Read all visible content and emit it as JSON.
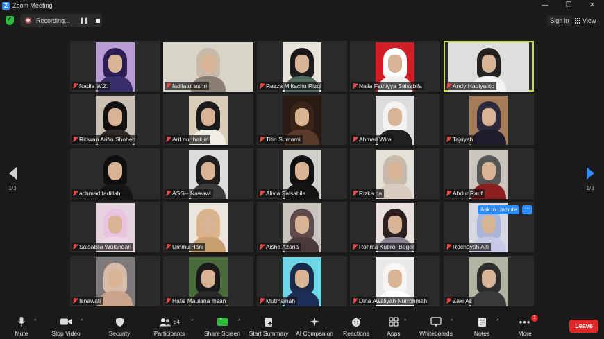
{
  "window": {
    "title": "Zoom Meeting"
  },
  "topbar": {
    "recording_label": "Recording...",
    "sign_in_label": "Sign in",
    "view_label": "View"
  },
  "pagination": {
    "left": "1/3",
    "right": "1/3"
  },
  "unmute_prompt": "Ask to Unmute",
  "participants": [
    {
      "name": "Nadia W.Z.",
      "bg": "#2a2a2a",
      "vbg": "#b89bd4",
      "hair": "#2c1e55",
      "body": "#3a2d6b"
    },
    {
      "name": "fadilatul ashri",
      "bg": "#2a2a2a",
      "vbg": "#d9d4c8",
      "hair": "#c9b9a8",
      "body": "#8a7f72"
    },
    {
      "name": "Rezza Miftachu Rizqi",
      "bg": "#2a2a2a",
      "vbg": "#e8e4dc",
      "hair": "#1a1a1a",
      "body": "#4d6a5a"
    },
    {
      "name": "Naila Fathiyya Salsabila",
      "bg": "#2a2a2a",
      "vbg": "#d01f24",
      "hair": "#ffffff",
      "body": "#f1f1f1"
    },
    {
      "name": "Andy Hadiyanto",
      "bg": "#2a2a2a",
      "vbg": "#dedede",
      "hair": "#222222",
      "body": "#f3f3f3"
    },
    {
      "name": "Ridwan Arifin Shoheh",
      "bg": "#2a2a2a",
      "vbg": "#c8bfb2",
      "hair": "#111111",
      "body": "#2f2a26"
    },
    {
      "name": "Arif nur hakim",
      "bg": "#2a2a2a",
      "vbg": "#d7cdb8",
      "hair": "#1b1b1b",
      "body": "#f0ece6"
    },
    {
      "name": "Titin Sumarni",
      "bg": "#2a2a2a",
      "vbg": "#2a1a14",
      "hair": "#3a2418",
      "body": "#5a3a2a"
    },
    {
      "name": "Ahmad Wira",
      "bg": "#2a2a2a",
      "vbg": "#dcdcdc",
      "hair": "#f4f4f4",
      "body": "#202020"
    },
    {
      "name": "Tajriyah",
      "bg": "#2a2a2a",
      "vbg": "#a47c59",
      "hair": "#2a2a3a",
      "body": "#1c1c2a"
    },
    {
      "name": "achmad fadillah",
      "bg": "#2a2a2a",
      "vbg": "#2a2a2a",
      "hair": "#0e0e0e",
      "body": "#151515"
    },
    {
      "name": "ASG-- Nawawi",
      "bg": "#2a2a2a",
      "vbg": "#dcdcdc",
      "hair": "#1d1d1d",
      "body": "#3a3a3a"
    },
    {
      "name": "Alivia Salsabila",
      "bg": "#2a2a2a",
      "vbg": "#d0cfcb",
      "hair": "#111111",
      "body": "#141414"
    },
    {
      "name": "Rizka qa",
      "bg": "#2a2a2a",
      "vbg": "#e4e0da",
      "hair": "#c8b8aa",
      "body": "#d9ccbf"
    },
    {
      "name": "Abdur Rauf",
      "bg": "#2a2a2a",
      "vbg": "#c9c4bd",
      "hair": "#555555",
      "body": "#8c2020"
    },
    {
      "name": "Salsabila Wulandari",
      "bg": "#2a2a2a",
      "vbg": "#e7d3de",
      "hair": "#e9c4e0",
      "body": "#f0d8e8"
    },
    {
      "name": "Ummu Hani",
      "bg": "#2a2a2a",
      "vbg": "#eae5df",
      "hair": "#d9b38a",
      "body": "#c89f6e"
    },
    {
      "name": "Aisha Azaria",
      "bg": "#2a2a2a",
      "vbg": "#c8c3bd",
      "hair": "#5e4a4a",
      "body": "#4a3a3a"
    },
    {
      "name": "Rohma Kubro_Bogor",
      "bg": "#2a2a2a",
      "vbg": "#e8e0dc",
      "hair": "#2c1f1f",
      "body": "#8a7f8f"
    },
    {
      "name": "Rochayah Alfi",
      "bg": "#2a2a2a",
      "vbg": "#d8d8e2",
      "hair": "#a8b4d8",
      "body": "#c7c9e6"
    },
    {
      "name": "Isnawati",
      "bg": "#2a2a2a",
      "vbg": "#7e7a7a",
      "hair": "#d6bca8",
      "body": "#c9a48a"
    },
    {
      "name": "Hafis Maulana Ihsan",
      "bg": "#2a2a2a",
      "vbg": "#4a6a3a",
      "hair": "#1a1a1a",
      "body": "#2a2a2a"
    },
    {
      "name": "Mutmainah",
      "bg": "#2a2a2a",
      "vbg": "#6fd6e6",
      "hair": "#1a2a4a",
      "body": "#1d2f58"
    },
    {
      "name": "Dina Awaliyah Nurrohmah",
      "bg": "#2a2a2a",
      "vbg": "#e9e9e9",
      "hair": "#f6f6f6",
      "body": "#ffffff"
    },
    {
      "name": "Zaki As",
      "bg": "#2a2a2a",
      "vbg": "#b1b5a2",
      "hair": "#2d2d2d",
      "body": "#3a3a3a"
    }
  ],
  "toolbar": {
    "mute": "Mute",
    "stop_video": "Stop Video",
    "security": "Security",
    "participants": "Participants",
    "participants_count": "54",
    "share_screen": "Share Screen",
    "start_summary": "Start Summary",
    "ai_companion": "AI Companion",
    "reactions": "Reactions",
    "apps": "Apps",
    "whiteboards": "Whiteboards",
    "notes": "Notes",
    "more": "More",
    "more_badge": "1",
    "leave": "Leave"
  }
}
